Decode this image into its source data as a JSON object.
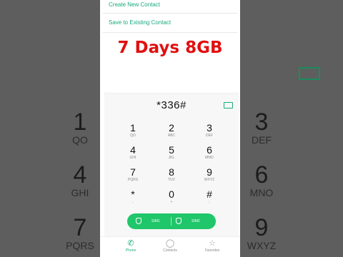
{
  "menu": {
    "create_new_contact": "Create New Contact",
    "save_to_existing": "Save to Existing Contact"
  },
  "promo_text": "7 Days 8GB",
  "dialer": {
    "number": "*336#",
    "keys": [
      {
        "digit": "1",
        "letters": "QO"
      },
      {
        "digit": "2",
        "letters": "ABC"
      },
      {
        "digit": "3",
        "letters": "DEF"
      },
      {
        "digit": "4",
        "letters": "GHI"
      },
      {
        "digit": "5",
        "letters": "JKL"
      },
      {
        "digit": "6",
        "letters": "MNO"
      },
      {
        "digit": "7",
        "letters": "PQRS"
      },
      {
        "digit": "8",
        "letters": "TUV"
      },
      {
        "digit": "9",
        "letters": "WXYZ"
      },
      {
        "digit": "*",
        "letters": ","
      },
      {
        "digit": "0",
        "letters": "+"
      },
      {
        "digit": "#",
        "letters": ";"
      }
    ],
    "sim1": "SIM1",
    "sim2": "SIM2",
    "accent": "#1fc66a"
  },
  "tabs": {
    "phone": "Phone",
    "contacts": "Contacts",
    "favorites": "Favorites"
  },
  "background_pad": {
    "k1": {
      "digit": "1",
      "letters": "QO"
    },
    "k3": {
      "digit": "3",
      "letters": "DEF"
    },
    "k4": {
      "digit": "4",
      "letters": "GHI"
    },
    "k6": {
      "digit": "6",
      "letters": "MNO"
    },
    "k7": {
      "digit": "7",
      "letters": "PQRS"
    },
    "k9": {
      "digit": "9",
      "letters": "WXYZ"
    }
  }
}
